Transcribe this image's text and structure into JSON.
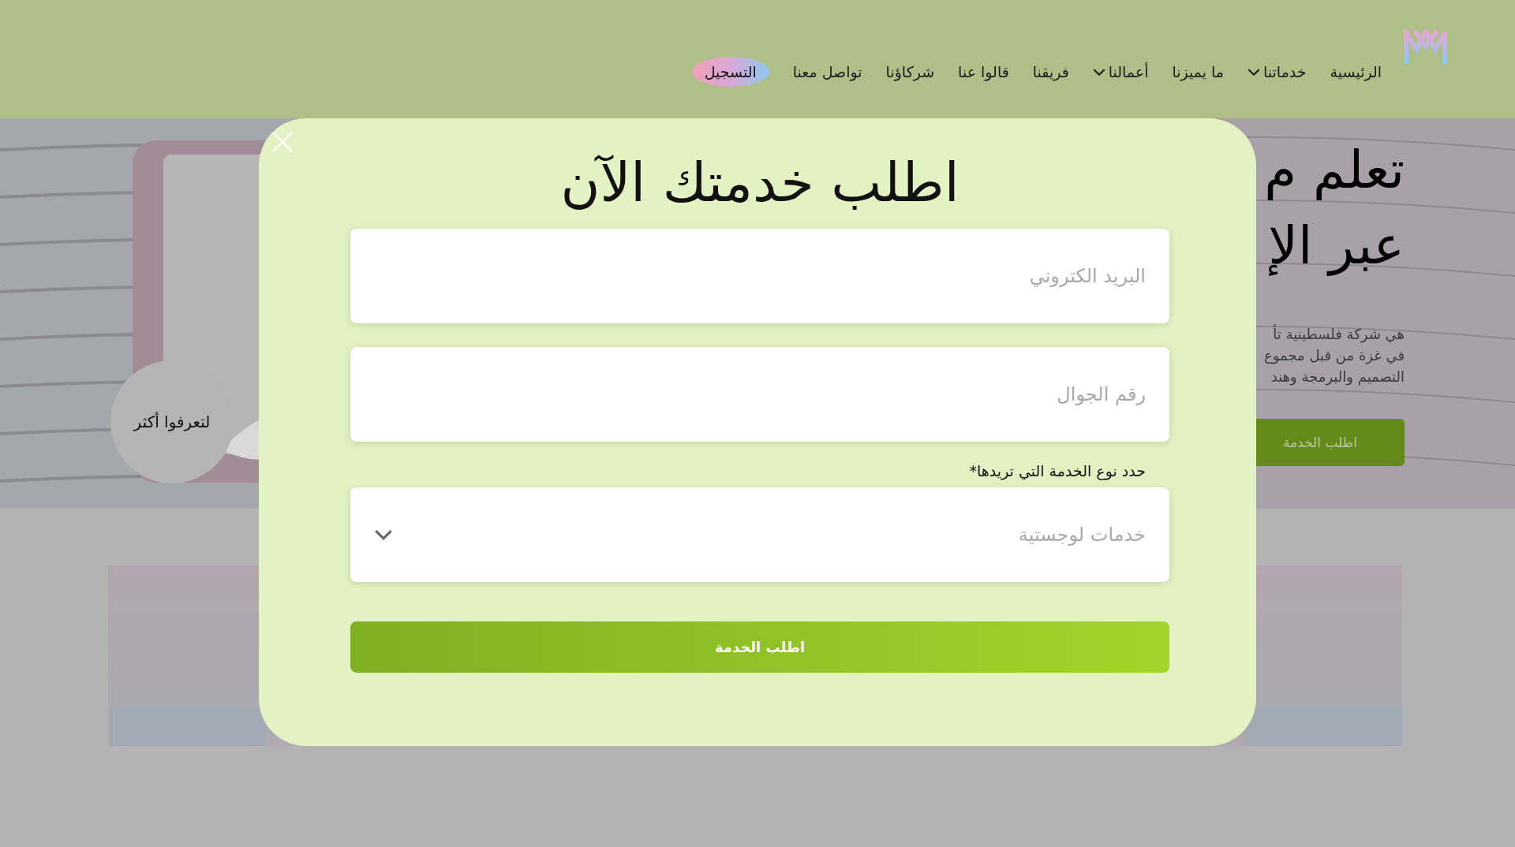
{
  "header": {
    "nav": [
      {
        "label": "الرئيسية",
        "dropdown": false
      },
      {
        "label": "خدماتنا",
        "dropdown": true
      },
      {
        "label": "ما يميزنا",
        "dropdown": false
      },
      {
        "label": "أعمالنا",
        "dropdown": true
      },
      {
        "label": "فريقنا",
        "dropdown": false
      },
      {
        "label": "قالوا عنا",
        "dropdown": false
      },
      {
        "label": "شركاؤنا",
        "dropdown": false
      },
      {
        "label": "تواصل معنا",
        "dropdown": false
      }
    ],
    "register_button": "التسجيل"
  },
  "hero": {
    "title_lines": [
      "تعلم م",
      "عبر الإ"
    ],
    "description_lines": [
      "هي شركة فلسطينية تأ",
      "في غزة من قبل مجموع",
      "التصميم والبرمجة وهند"
    ],
    "cta_button": "اطلب الخدمة",
    "learn_more_button": "لتعرفوا أكثر"
  },
  "modal": {
    "title": "اطلب خدمتك الآن",
    "fields": [
      {
        "kind": "text",
        "placeholder": "البريد الكتروني"
      },
      {
        "kind": "text",
        "placeholder": "رقم الجوال"
      },
      {
        "kind": "select",
        "label": "حدد نوع الخدمة التي تريدها*",
        "value": "خدمات لوجستية"
      }
    ],
    "submit_button": "اطلب الخدمة"
  }
}
